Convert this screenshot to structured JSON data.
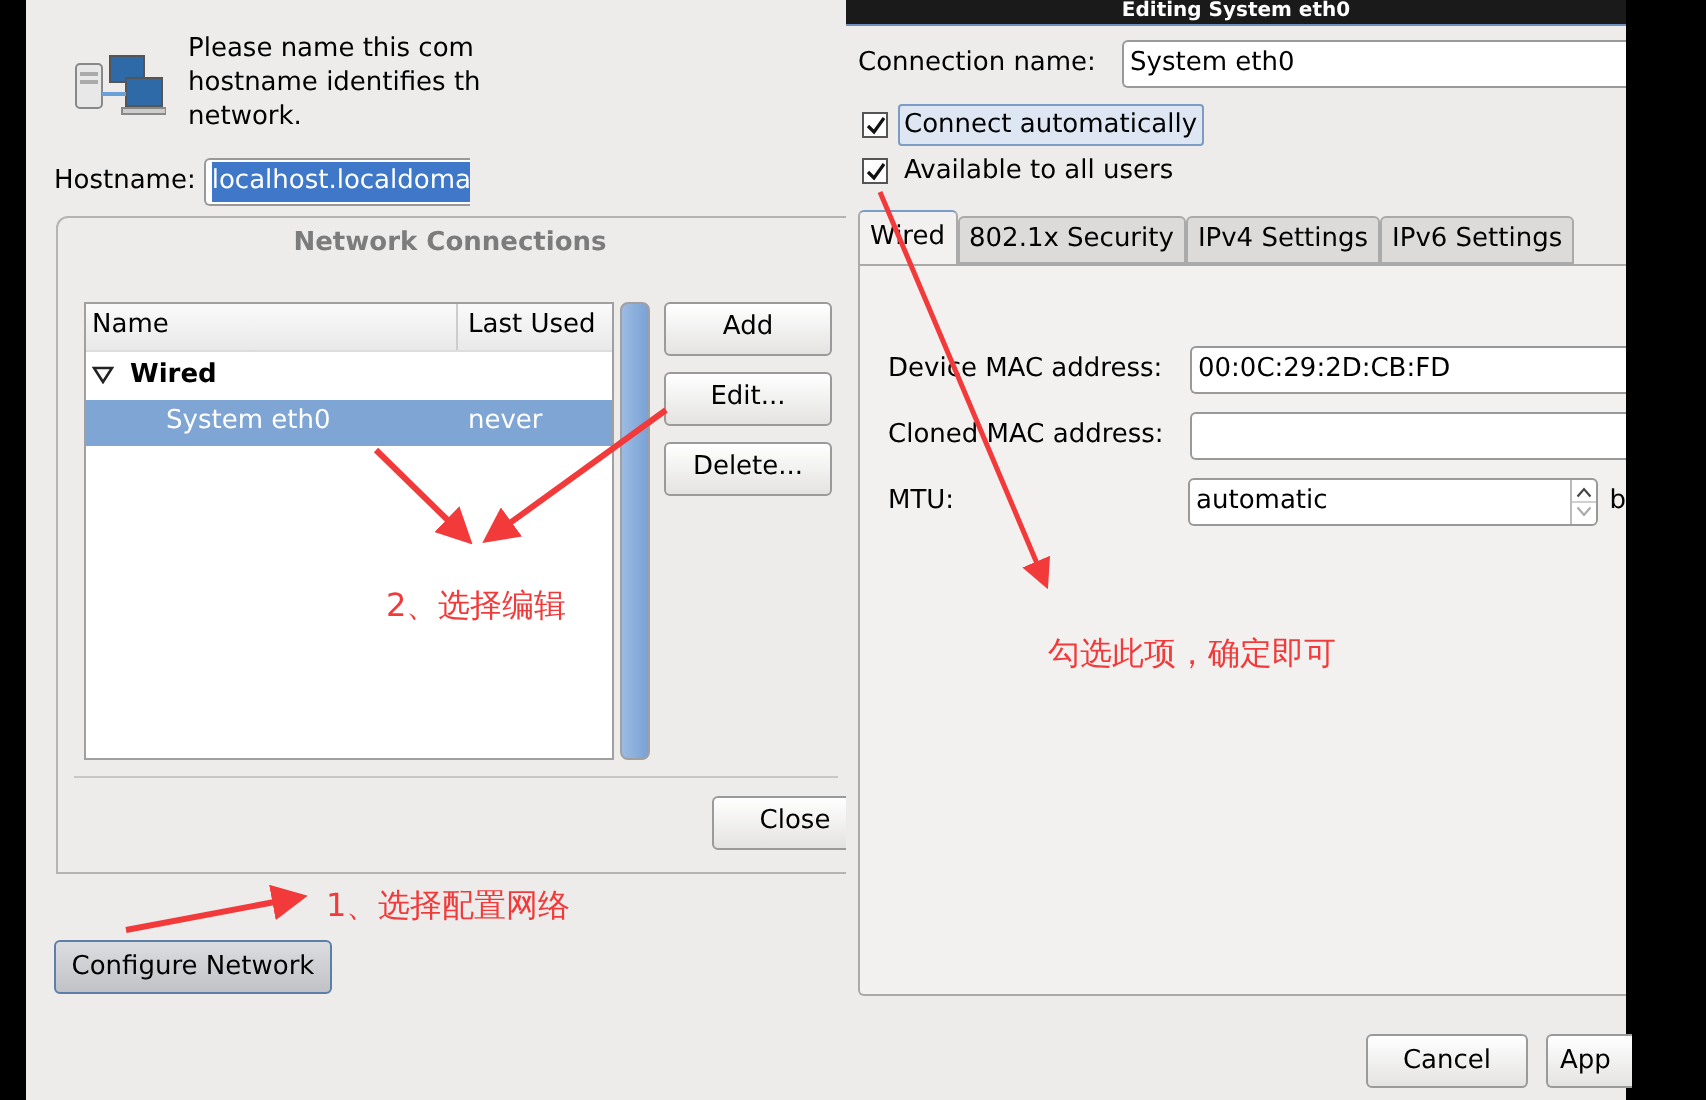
{
  "network_window": {
    "intro_lines": [
      "Please name this com",
      "hostname identifies th",
      "network."
    ],
    "hostname": {
      "label": "Hostname:",
      "value": "localhost.localdoma",
      "selected": true
    },
    "connections": {
      "title": "Network Connections",
      "columns": [
        "Name",
        "Last Used"
      ],
      "groups": [
        {
          "label": "Wired",
          "expanded": true,
          "rows": [
            {
              "name": "System eth0",
              "last_used": "never",
              "selected": true
            }
          ]
        }
      ],
      "buttons": [
        "Add",
        "Edit...",
        "Delete..."
      ],
      "close": "Close"
    },
    "configure_button": "Configure Network"
  },
  "edit_dialog": {
    "title": "Editing System eth0",
    "connection_name": {
      "label": "Connection name:",
      "value": "System eth0"
    },
    "checkboxes": [
      {
        "label": "Connect automatically",
        "checked": true,
        "focused": true
      },
      {
        "label": "Available to all users",
        "checked": true,
        "focused": false
      }
    ],
    "tabs": [
      {
        "label": "Wired",
        "selected": true
      },
      {
        "label": "802.1x Security",
        "selected": false
      },
      {
        "label": "IPv4 Settings",
        "selected": false
      },
      {
        "label": "IPv6 Settings",
        "selected": false
      }
    ],
    "fields": [
      {
        "kind": "text",
        "label": "Device MAC address:",
        "value": "00:0C:29:2D:CB:FD"
      },
      {
        "kind": "text",
        "label": "Cloned MAC address:"
      },
      {
        "kind": "spin",
        "label": "MTU:",
        "value": "automatic",
        "unit": "b"
      }
    ],
    "buttons": [
      "Cancel",
      "App"
    ]
  },
  "annotations": [
    "2、选择编辑",
    "勾选此项，确定即可",
    "1、选择配置网络"
  ]
}
